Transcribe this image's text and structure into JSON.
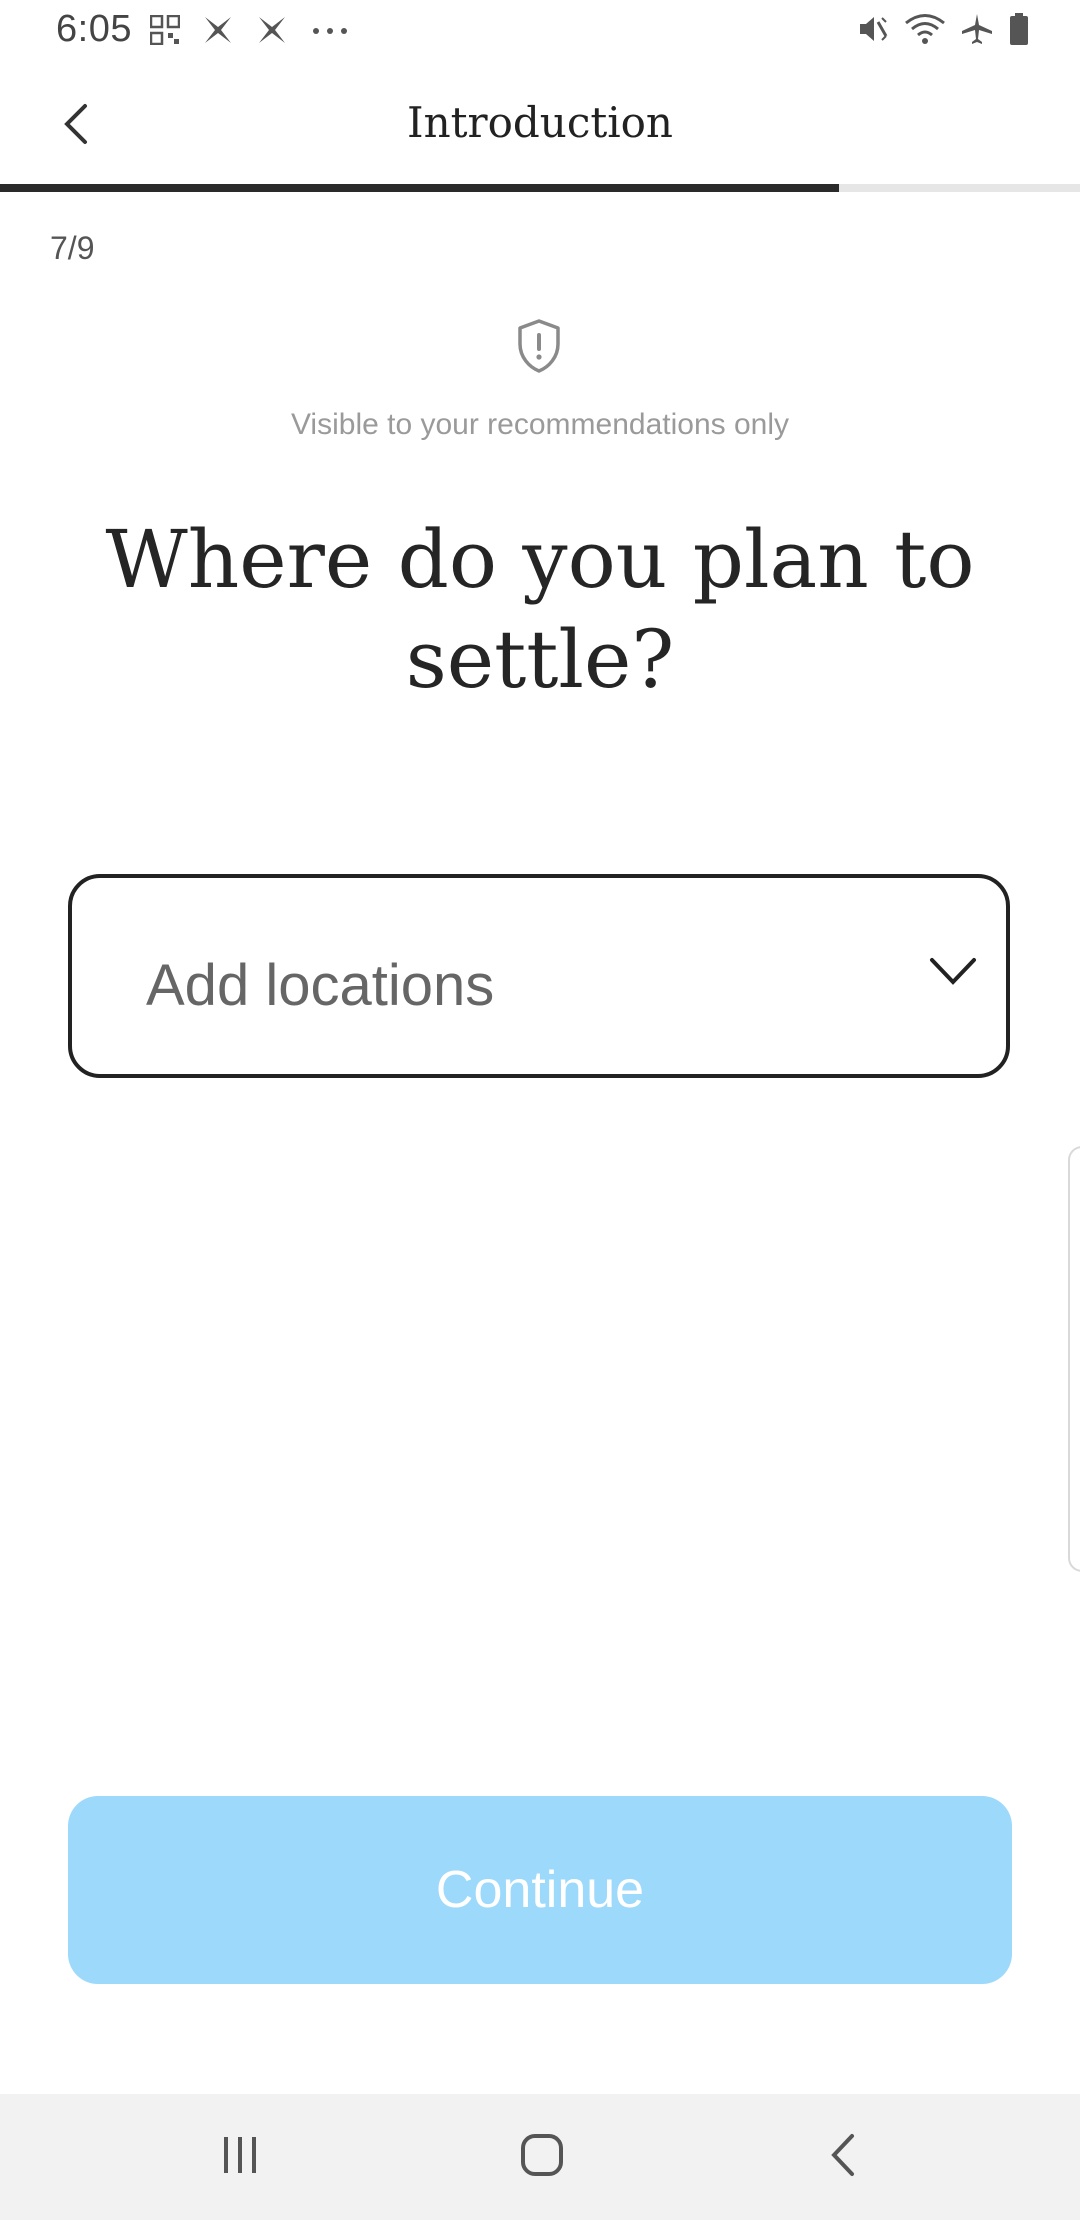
{
  "status_bar": {
    "time": "6:05",
    "left_icons": [
      "qr-code-icon",
      "app-x-icon",
      "app-x-icon",
      "more-dots-icon"
    ],
    "right_icons": [
      "vibrate-mute-icon",
      "wifi-icon",
      "airplane-icon",
      "battery-icon"
    ]
  },
  "header": {
    "title": "Introduction",
    "back_icon": "chevron-left-icon"
  },
  "progress": {
    "current": 7,
    "total": 9,
    "fraction": 0.777,
    "label": "7/9"
  },
  "privacy": {
    "icon": "shield-alert-icon",
    "note": "Visible to your recommendations only"
  },
  "question": {
    "text": "Where do you plan to settle?"
  },
  "location_select": {
    "placeholder": "Add locations",
    "icon": "chevron-down-icon"
  },
  "actions": {
    "continue_label": "Continue",
    "continue_color": "#9dd9fb"
  },
  "nav_bar": {
    "buttons": [
      "recent-apps-icon",
      "home-icon",
      "back-icon"
    ]
  }
}
